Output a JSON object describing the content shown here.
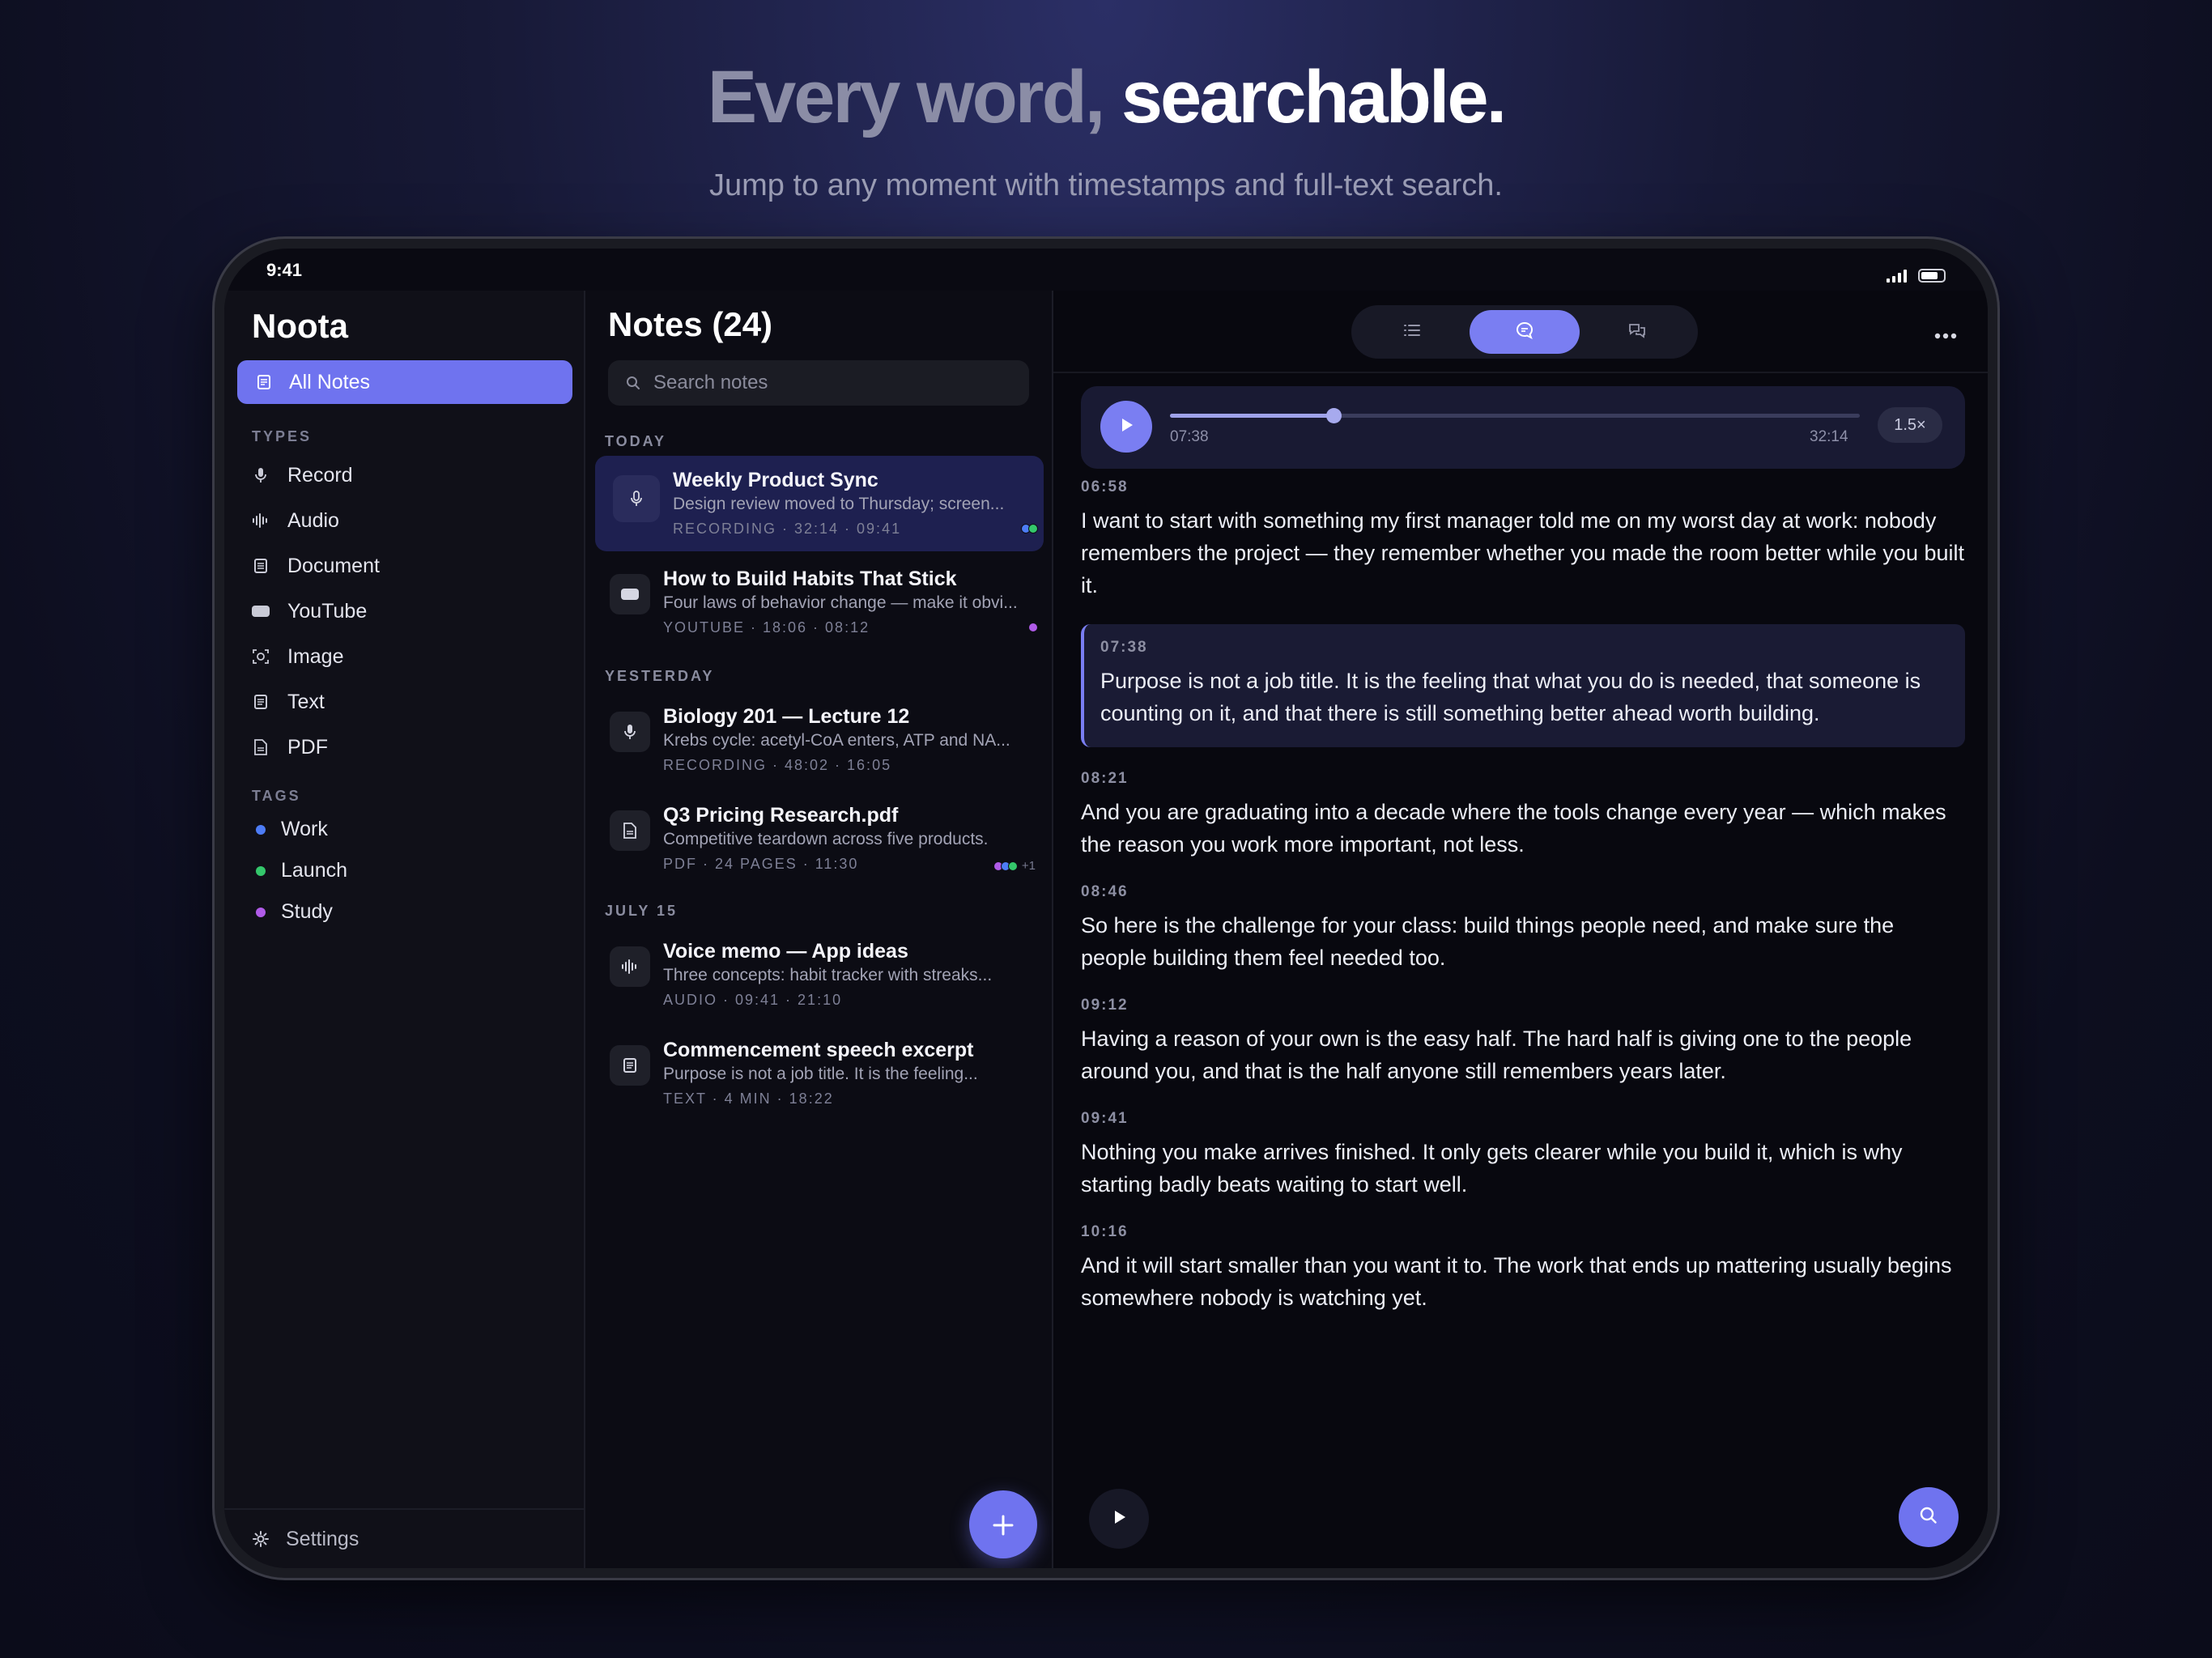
{
  "hero": {
    "title_dim": "Every word,",
    "title_bright": "searchable.",
    "subtitle": "Jump to any moment with timestamps and full-text search."
  },
  "status": {
    "time": "9:41"
  },
  "sidebar": {
    "app_title": "Noota",
    "all_notes": "All Notes",
    "types_label": "TYPES",
    "types": [
      "Record",
      "Audio",
      "Document",
      "YouTube",
      "Image",
      "Text",
      "PDF"
    ],
    "tags_label": "TAGS",
    "tags": [
      {
        "label": "Work",
        "color": "#4d7cf6"
      },
      {
        "label": "Launch",
        "color": "#34c76b"
      },
      {
        "label": "Study",
        "color": "#b05be8"
      }
    ],
    "settings": "Settings"
  },
  "notes": {
    "title": "Notes (24)",
    "search_placeholder": "Search notes",
    "groups": [
      "TODAY",
      "YESTERDAY",
      "JULY 15"
    ],
    "items": [
      {
        "title": "Weekly Product Sync",
        "snippet": "Design review moved to Thursday; screen...",
        "meta": "RECORDING · 32:14 · 09:41",
        "icon": "mic-icon"
      },
      {
        "title": "How to Build Habits That Stick",
        "snippet": "Four laws of behavior change — make it obvi...",
        "meta": "YOUTUBE · 18:06 · 08:12",
        "icon": "youtube-icon"
      },
      {
        "title": "Biology 201 — Lecture 12",
        "snippet": "Krebs cycle: acetyl-CoA enters, ATP and NA...",
        "meta": "RECORDING · 48:02 · 16:05",
        "icon": "mic-icon"
      },
      {
        "title": "Q3 Pricing Research.pdf",
        "snippet": "Competitive teardown across five products.",
        "meta": "PDF · 24 PAGES · 11:30",
        "icon": "pdf-icon",
        "more": "+1"
      },
      {
        "title": "Voice memo — App ideas",
        "snippet": "Three concepts: habit tracker with streaks...",
        "meta": "AUDIO · 09:41 · 21:10",
        "icon": "waveform-icon"
      },
      {
        "title": "Commencement speech excerpt",
        "snippet": "Purpose is not a job title. It is the feeling...",
        "meta": "TEXT · 4 MIN · 18:22",
        "icon": "text-icon"
      }
    ]
  },
  "player": {
    "current": "07:38",
    "duration": "32:14",
    "speed": "1.5×",
    "progress": 0.237
  },
  "transcript": [
    {
      "ts": "06:58",
      "text": "I want to start with something my first manager told me on my worst day at work: nobody remembers the project — they remember whether you made the room better while you built it."
    },
    {
      "ts": "07:38",
      "text": "Purpose is not a job title. It is the feeling that what you do is needed, that someone is counting on it, and that there is still something better ahead worth building.",
      "current": true
    },
    {
      "ts": "08:21",
      "text": "And you are graduating into a decade where the tools change every year — which makes the reason you work more important, not less."
    },
    {
      "ts": "08:46",
      "text": "So here is the challenge for your class: build things people need, and make sure the people building them feel needed too."
    },
    {
      "ts": "09:12",
      "text": "Having a reason of your own is the easy half. The hard half is giving one to the people around you, and that is the half anyone still remembers years later."
    },
    {
      "ts": "09:41",
      "text": "Nothing you make arrives finished. It only gets clearer while you build it, which is why starting badly beats waiting to start well."
    },
    {
      "ts": "10:16",
      "text": "And it will start smaller than you want it to. The work that ends up mattering usually begins somewhere nobody is watching yet."
    }
  ],
  "colors": {
    "accent": "#6f73ef",
    "active_note": "#1e2050"
  }
}
